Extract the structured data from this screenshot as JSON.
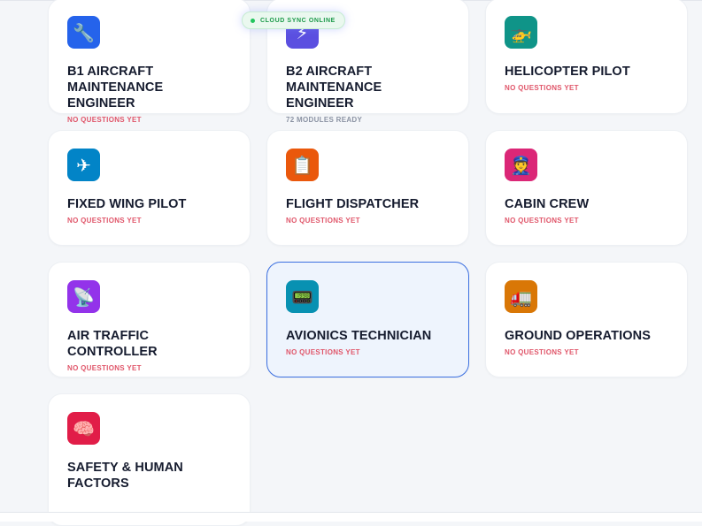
{
  "status_badge": {
    "label": "CLOUD SYNC ONLINE"
  },
  "cards": [
    {
      "title": "B1 AIRCRAFT MAINTENANCE ENGINEER",
      "subtitle": "NO QUESTIONS YET",
      "icon": "wrench-icon",
      "glyph": "🔧",
      "color": "#2563eb"
    },
    {
      "title": "B2 AIRCRAFT MAINTENANCE ENGINEER",
      "subtitle": "72 MODULES READY",
      "icon": "lightning-icon",
      "glyph": "⚡",
      "color": "#5b4fe0"
    },
    {
      "title": "HELICOPTER PILOT",
      "subtitle": "NO QUESTIONS YET",
      "icon": "helicopter-icon",
      "glyph": "🚁",
      "color": "#0f9488"
    },
    {
      "title": "FIXED WING PILOT",
      "subtitle": "NO QUESTIONS YET",
      "icon": "airplane-icon",
      "glyph": "✈",
      "color": "#0284c7"
    },
    {
      "title": "FLIGHT DISPATCHER",
      "subtitle": "NO QUESTIONS YET",
      "icon": "clipboard-icon",
      "glyph": "📋",
      "color": "#ea580c"
    },
    {
      "title": "CABIN CREW",
      "subtitle": "NO QUESTIONS YET",
      "icon": "crew-member-icon",
      "glyph": "👮",
      "color": "#db2777"
    },
    {
      "title": "AIR TRAFFIC CONTROLLER",
      "subtitle": "NO QUESTIONS YET",
      "icon": "satellite-dish-icon",
      "glyph": "📡",
      "color": "#9333ea"
    },
    {
      "title": "AVIONICS TECHNICIAN",
      "subtitle": "NO QUESTIONS YET",
      "icon": "pager-icon",
      "glyph": "📟",
      "color": "#0891b2",
      "selected": true
    },
    {
      "title": "GROUND OPERATIONS",
      "subtitle": "NO QUESTIONS YET",
      "icon": "truck-icon",
      "glyph": "🚛",
      "color": "#d97706"
    },
    {
      "title": "SAFETY & HUMAN FACTORS",
      "subtitle": "",
      "icon": "brain-icon",
      "glyph": "🧠",
      "color": "#e11d48"
    }
  ]
}
